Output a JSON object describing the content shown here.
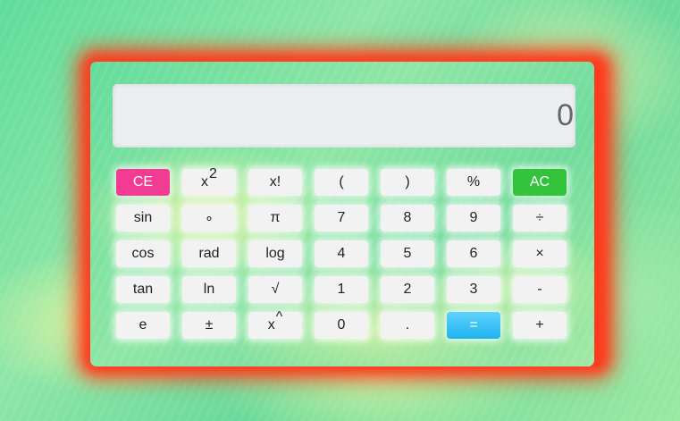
{
  "display": {
    "value": "0"
  },
  "keys": {
    "row1": {
      "ce": "CE",
      "square_base": "x",
      "square_exp": "2",
      "factorial": "x!",
      "open_paren": "(",
      "close_paren": ")",
      "percent": "%",
      "ac": "AC"
    },
    "row2": {
      "sin": "sin",
      "degree": "∘",
      "pi": "π",
      "seven": "7",
      "eight": "8",
      "nine": "9",
      "divide": "÷"
    },
    "row3": {
      "cos": "cos",
      "rad": "rad",
      "log": "log",
      "four": "4",
      "five": "5",
      "six": "6",
      "multiply": "×"
    },
    "row4": {
      "tan": "tan",
      "ln": "ln",
      "sqrt": "√",
      "one": "1",
      "two": "2",
      "three": "3",
      "minus": "-"
    },
    "row5": {
      "e": "e",
      "plus_minus": "±",
      "power_base": "x",
      "power_sym": "^",
      "zero": "0",
      "decimal": ".",
      "equals": "=",
      "plus": "+"
    }
  },
  "colors": {
    "ce": "#f23c94",
    "ac": "#33c33b",
    "equals": "#1fb2ee",
    "glow": "#ff3b1e",
    "display_bg": "#eceff1"
  }
}
